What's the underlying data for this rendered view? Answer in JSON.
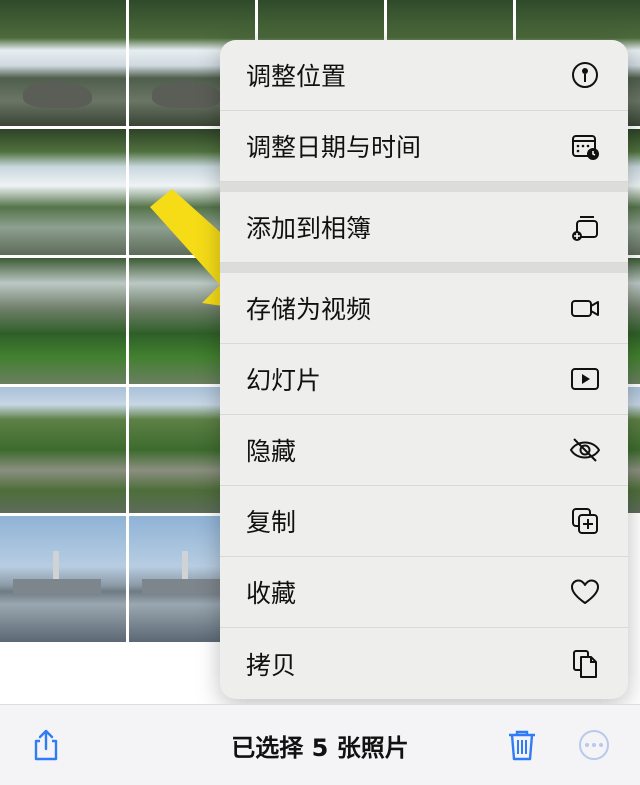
{
  "grid": {
    "photos": [
      "wf-a",
      "wf-a",
      "wf-a",
      "wf-a",
      "wf-a",
      "wf-b",
      "wf-b",
      "wf-b",
      "wf-b",
      "wf-b",
      "wf-c",
      "wf-c",
      "wf-c",
      "wf-c",
      "wf-c",
      "wf-d",
      "wf-d",
      "wf-d",
      "wf-d",
      "city",
      "city",
      "city",
      "city",
      "city",
      "city"
    ]
  },
  "menu": {
    "items": [
      {
        "label": "调整位置",
        "icon": "location-pin-icon"
      },
      {
        "label": "调整日期与时间",
        "icon": "calendar-clock-icon"
      },
      {
        "label": "添加到相簿",
        "icon": "add-to-album-icon"
      },
      {
        "label": "存储为视频",
        "icon": "video-camera-icon"
      },
      {
        "label": "幻灯片",
        "icon": "play-slideshow-icon"
      },
      {
        "label": "隐藏",
        "icon": "eye-slash-icon"
      },
      {
        "label": "复制",
        "icon": "duplicate-icon"
      },
      {
        "label": "收藏",
        "icon": "heart-icon"
      },
      {
        "label": "拷贝",
        "icon": "copy-icon"
      }
    ]
  },
  "toolbar": {
    "status": "已选择 5 张照片",
    "share_icon": "share-icon",
    "delete_icon": "trash-icon",
    "more_icon": "more-icon"
  },
  "colors": {
    "accent": "#2f7cf6",
    "arrow": "#f5dc17",
    "menu_bg": "#eeeeec"
  }
}
